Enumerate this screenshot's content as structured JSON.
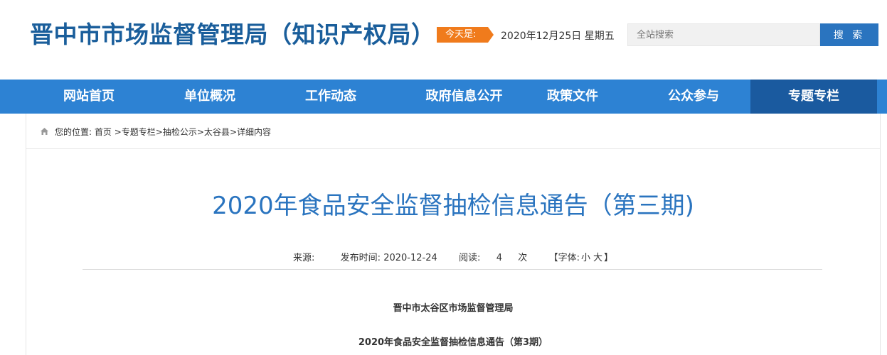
{
  "header": {
    "site_title": "晋中市市场监督管理局（知识产权局）",
    "today_label": "今天是:",
    "today_date": "2020年12月25日 星期五",
    "search_placeholder": "全站搜索",
    "search_button": "搜 索"
  },
  "nav": {
    "items": [
      {
        "label": "网站首页"
      },
      {
        "label": "单位概况"
      },
      {
        "label": "工作动态"
      },
      {
        "label": "政府信息公开"
      },
      {
        "label": "政策文件"
      },
      {
        "label": "公众参与"
      },
      {
        "label": "专题专栏",
        "active": true
      }
    ]
  },
  "breadcrumb": {
    "prefix": "您的位置:",
    "home": "首页",
    "sep": " >",
    "topic": "专题专栏",
    "notice": "抽检公示",
    "county": "太谷县",
    "detail": "详细内容"
  },
  "article": {
    "title": "2020年食品安全监督抽检信息通告（第三期)",
    "source_label": "来源:",
    "published_label": "发布时间:",
    "published_date": "2020-12-24",
    "reads_label": "阅读:",
    "reads_count": "4",
    "reads_unit": "次",
    "font_open": "【字体:",
    "font_small": "小",
    "font_large": "大",
    "font_close": "】",
    "org_line": "晋中市太谷区市场监督管理局",
    "subtitle_line": "2020年食品安全监督抽检信息通告（第3期）"
  },
  "colors": {
    "brand": "#1a5e9b",
    "nav_bg": "#2d82d3",
    "nav_active": "#1a5a9f",
    "today_badge": "#f07b1c",
    "title_blue": "#2a74bf"
  },
  "icons": {
    "breadcrumb": "home-icon"
  }
}
